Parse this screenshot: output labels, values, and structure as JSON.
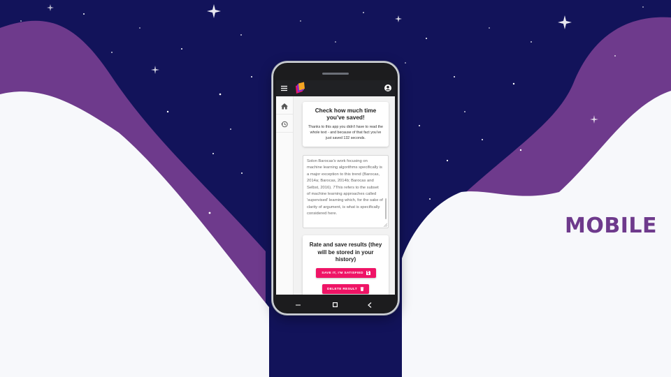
{
  "slide": {
    "label": "MOBILE"
  },
  "colors": {
    "night_sky": "#12135a",
    "purple_wave": "#6e3a8c",
    "page_bg": "#f7f8fb",
    "accent": "#ef1466",
    "appbar": "#202124",
    "label": "#6e3a8c"
  },
  "appbar": {
    "menu_icon": "menu-icon",
    "logo_icon": "app-logo-icon",
    "account_icon": "account-circle-icon"
  },
  "rail": {
    "items": [
      {
        "icon": "home-icon"
      },
      {
        "icon": "history-icon"
      }
    ]
  },
  "saved_card": {
    "title": "Check how much time you've saved!",
    "text": "Thanks to this app you didn't have to read the whole text - and because of that fact you've just saved 132 seconds."
  },
  "summary": {
    "text": "Solon Barocas's work focusing on machine learning algorithms specifically is a major exception to this trend (Barocas, 2014a; Barocas, 2014b; Barocas and Selbst, 2016). 7This refers to the subset of machine learning approaches called 'supervised' learning which, for the sake of clarity of argument, is what is specifically considered here."
  },
  "rate_card": {
    "title": "Rate and save results (they will be stored in your history)",
    "save_label": "SAVE IT, I'M SATISFIED",
    "save_icon": "floppy-disk-icon",
    "delete_label": "DELETE RESULT",
    "delete_icon": "trash-icon"
  },
  "navbar": {
    "back_icon": "back-icon",
    "home_icon": "home-square-icon",
    "recent_icon": "recent-apps-icon"
  }
}
